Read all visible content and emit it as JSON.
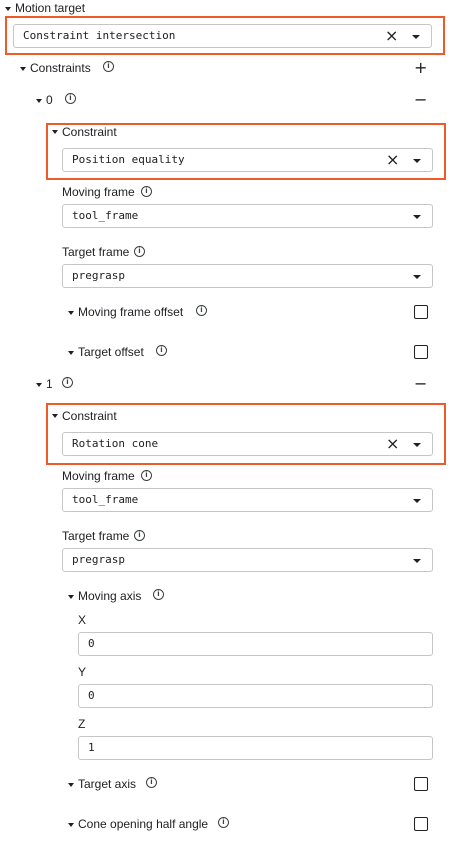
{
  "motion_target": {
    "label": "Motion target",
    "value": "Constraint intersection"
  },
  "constraints": {
    "label": "Constraints",
    "add_symbol": "+",
    "info_symbol": "i",
    "items": [
      {
        "index": "0",
        "remove_symbol": "−",
        "constraint_label": "Constraint",
        "constraint_value": "Position equality",
        "moving_frame_label": "Moving frame",
        "moving_frame_value": "tool_frame",
        "target_frame_label": "Target frame",
        "target_frame_value": "pregrasp",
        "moving_frame_offset_label": "Moving frame offset",
        "target_offset_label": "Target offset"
      },
      {
        "index": "1",
        "remove_symbol": "−",
        "constraint_label": "Constraint",
        "constraint_value": "Rotation cone",
        "moving_frame_label": "Moving frame",
        "moving_frame_value": "tool_frame",
        "target_frame_label": "Target frame",
        "target_frame_value": "pregrasp",
        "moving_axis": {
          "label": "Moving axis",
          "x_label": "X",
          "x_value": "0",
          "y_label": "Y",
          "y_value": "0",
          "z_label": "Z",
          "z_value": "1"
        },
        "target_axis_label": "Target axis",
        "cone_angle_label": "Cone opening half angle"
      }
    ]
  },
  "icons": {
    "clear": "close-icon",
    "dropdown": "dropdown-arrow-icon",
    "info": "info-icon",
    "expand": "caret-down-icon"
  },
  "colors": {
    "highlight": "#f05a28",
    "border": "#c4c7c5",
    "text": "#202124"
  }
}
